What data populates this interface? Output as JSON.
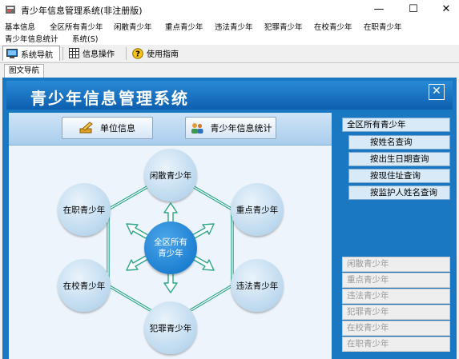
{
  "window": {
    "title": "青少年信息管理系统(非注册版)",
    "controls": {
      "minimize": "—",
      "maximize": "☐",
      "close": "✕"
    }
  },
  "menu": {
    "items": [
      "基本信息",
      "全区所有青少年",
      "闲散青少年",
      "重点青少年",
      "违法青少年",
      "犯罪青少年",
      "在校青少年",
      "在职青少年",
      "青少年信息统计",
      "系统(S)"
    ]
  },
  "toolbar": {
    "items": [
      {
        "label": "系统导航",
        "icon": "monitor-icon"
      },
      {
        "label": "信息操作",
        "icon": "grid-icon"
      },
      {
        "label": "使用指南",
        "icon": "help-icon"
      }
    ]
  },
  "tab": {
    "label": "图文导航"
  },
  "banner": {
    "title": "青少年信息管理系统",
    "close": "✕"
  },
  "buttons": {
    "unit": {
      "label": "单位信息",
      "icon": "pencil-icon"
    },
    "stats": {
      "label": "青少年信息统计",
      "icon": "people-icon"
    }
  },
  "diagram": {
    "center": {
      "line1": "全区所有",
      "line2": "青少年"
    },
    "nodes": {
      "idle": "闲散青少年",
      "key": "重点青少年",
      "illegal": "违法青少年",
      "crime": "犯罪青少年",
      "school": "在校青少年",
      "employed": "在职青少年"
    }
  },
  "right_panel": {
    "header": "全区所有青少年",
    "queries": [
      "按姓名查询",
      "按出生日期查询",
      "按现住址查询",
      "按监护人姓名查询"
    ],
    "categories": [
      "闲散青少年",
      "重点青少年",
      "违法青少年",
      "犯罪青少年",
      "在校青少年",
      "在职青少年"
    ]
  },
  "colors": {
    "panel_blue": "#1a78c2",
    "node_blue": "#1e80d2",
    "connector_green": "#2aa58a"
  }
}
